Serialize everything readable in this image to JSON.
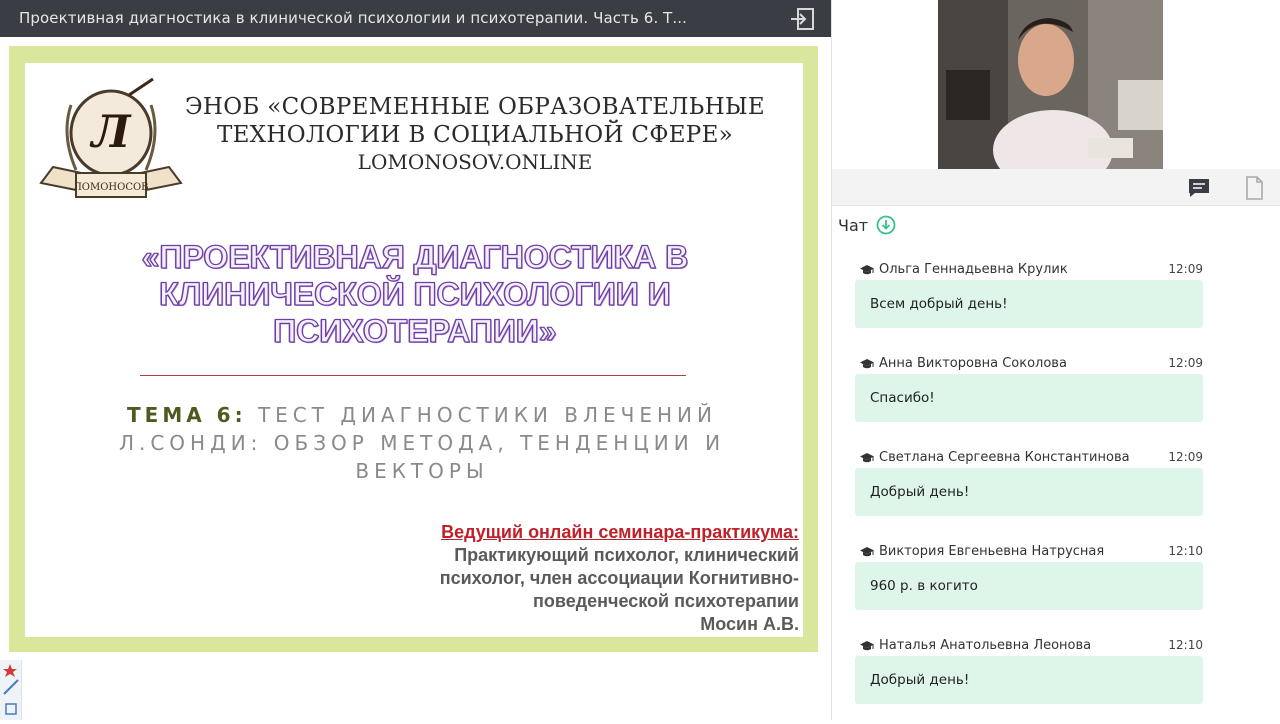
{
  "window": {
    "title": "Проективная диагностика в клинической психологии и психотерапии. Часть 6. Т...",
    "exit_icon": "exit-icon"
  },
  "slide": {
    "org_line1": "ЭНОБ «СОВРЕМЕННЫЕ ОБРАЗОВАТЕЛЬНЫЕ",
    "org_line2": "ТЕХНОЛОГИИ В СОЦИАЛЬНОЙ СФЕРЕ»",
    "org_line3": "LOMONOSOV.ONLINE",
    "logo_letter": "Л",
    "logo_banner": "ЛОМОНОСОВ",
    "title_line1": "«ПРОЕКТИВНАЯ ДИАГНОСТИКА В",
    "title_line2": "КЛИНИЧЕСКОЙ ПСИХОЛОГИИ И",
    "title_line3": "ПСИХОТЕРАПИИ»",
    "theme_label": "ТЕМА 6:",
    "theme_line1": "ТЕСТ ДИАГНОСТИКИ ВЛЕЧЕНИЙ",
    "theme_line2": "Л.СОНДИ: ОБЗОР МЕТОДА, ТЕНДЕНЦИИ И",
    "theme_line3": "ВЕКТОРЫ",
    "presenter_lead": "Ведущий онлайн семинара-практикума:",
    "presenter_line1": "Практикующий психолог, клинический",
    "presenter_line2": "психолог, член ассоциации Когнитивно-",
    "presenter_line3": "поведенческой психотерапии",
    "presenter_name": "Мосин А.В."
  },
  "tabs": {
    "chat_icon": "chat-icon",
    "document_icon": "document-icon"
  },
  "chat": {
    "header": "Чат",
    "messages": [
      {
        "author": "Ольга Геннадьевна Крулик",
        "time": "12:09",
        "text": "Всем добрый день!"
      },
      {
        "author": "Анна Викторовна Соколова",
        "time": "12:09",
        "text": "Спасибо!"
      },
      {
        "author": "Светлана Сергеевна Константинова",
        "time": "12:09",
        "text": "Добрый день!"
      },
      {
        "author": "Виктория Евгеньевна Натрусная",
        "time": "12:10",
        "text": "960 р. в когито"
      },
      {
        "author": "Наталья Анатольевна Леонова",
        "time": "12:10",
        "text": "Добрый день!"
      }
    ]
  },
  "colors": {
    "topbar": "#3a3d44",
    "slide_frame": "#d9e79c",
    "bubble": "#def5ea",
    "accent_green": "#35c28a",
    "title_purple": "#6a3fa3",
    "presenter_red": "#c0202a"
  }
}
